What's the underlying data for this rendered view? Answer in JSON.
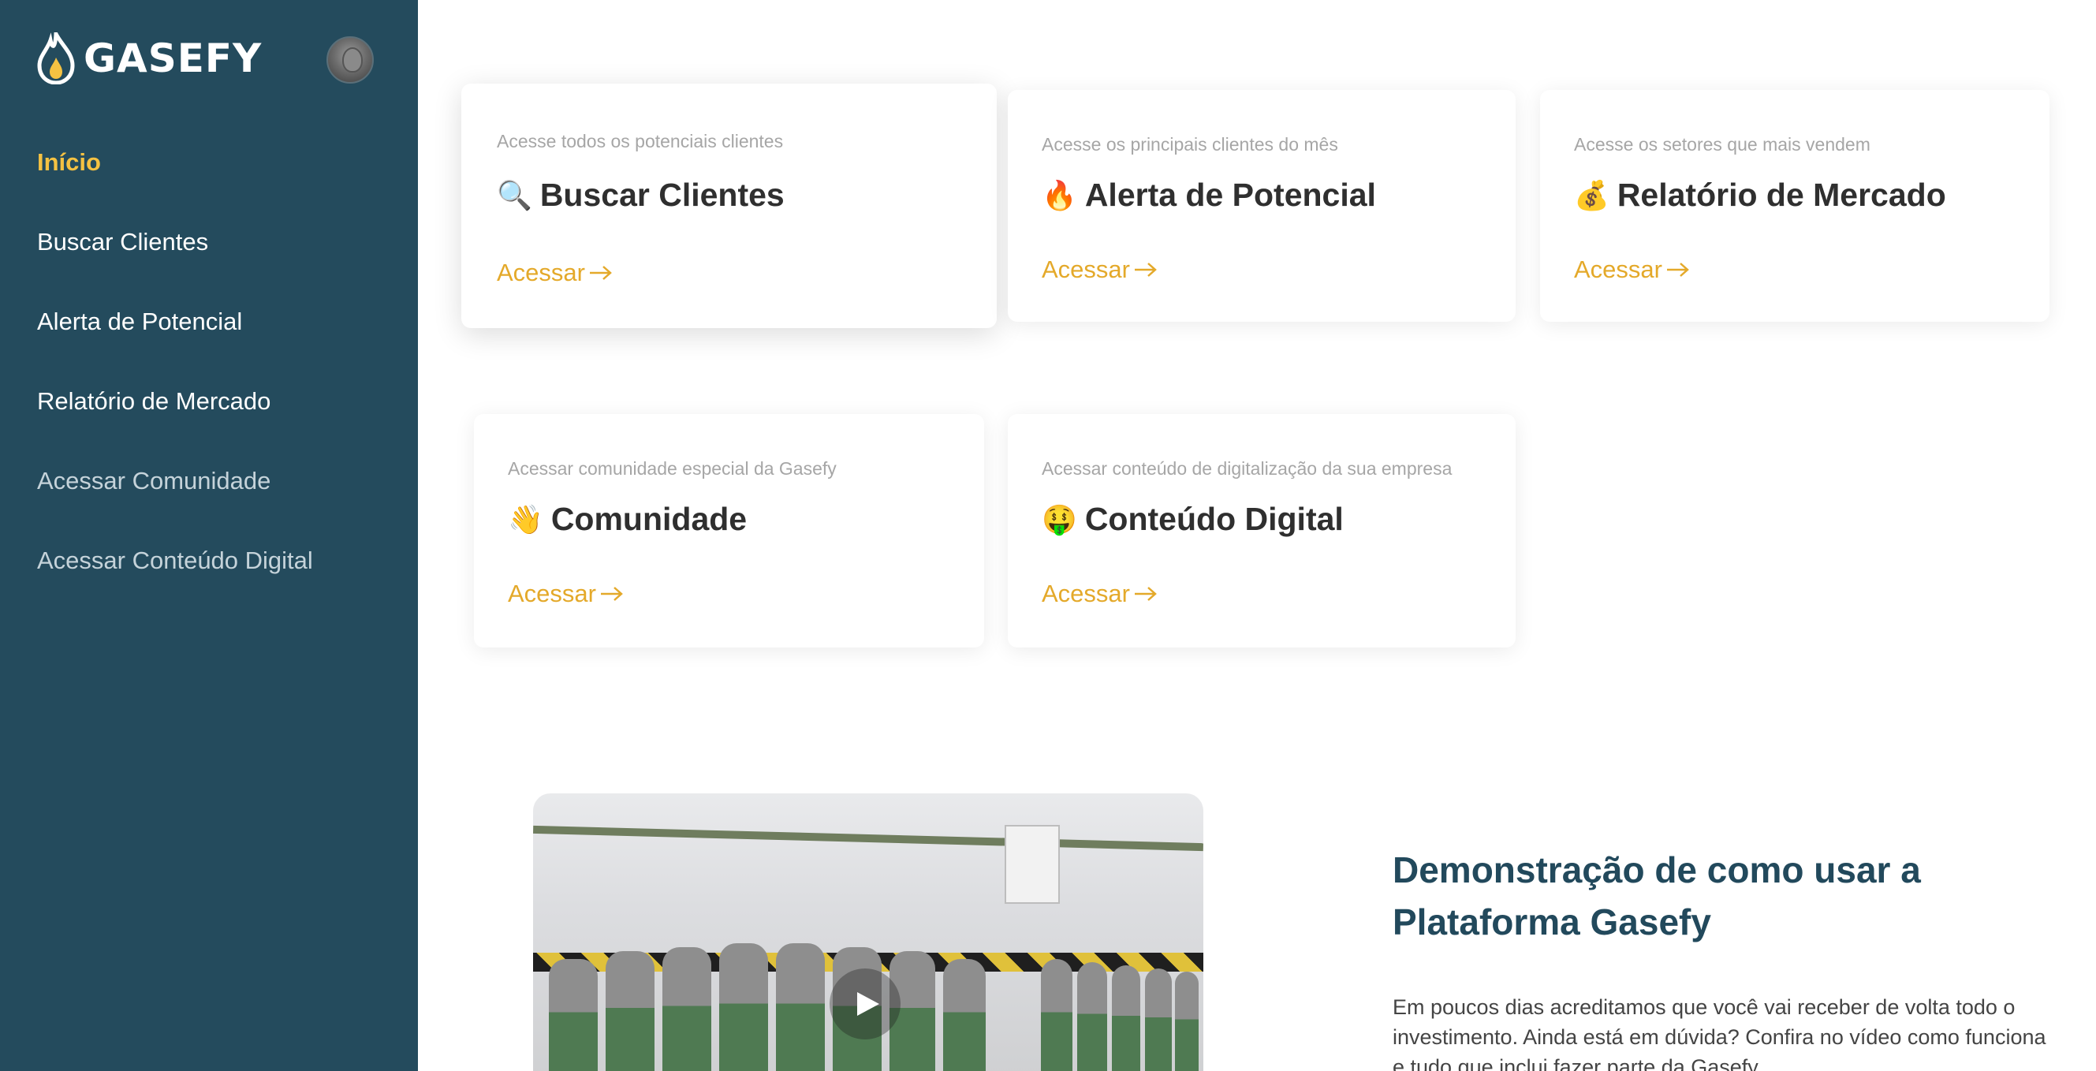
{
  "brand": {
    "name": "GASEFY"
  },
  "sidebar": {
    "items": [
      {
        "label": "Início"
      },
      {
        "label": "Buscar Clientes"
      },
      {
        "label": "Alerta de Potencial"
      },
      {
        "label": "Relatório de Mercado"
      },
      {
        "label": "Acessar Comunidade"
      },
      {
        "label": "Acessar Conteúdo Digital"
      }
    ]
  },
  "cards": [
    {
      "subtitle": "Acesse todos os potenciais clientes",
      "emoji": "🔍",
      "title": "Buscar Clientes",
      "link": "Acessar"
    },
    {
      "subtitle": "Acesse os principais clientes do mês",
      "emoji": "🔥",
      "title": "Alerta de Potencial",
      "link": "Acessar"
    },
    {
      "subtitle": "Acesse os setores que mais vendem",
      "emoji": "💰",
      "title": "Relatório de Mercado",
      "link": "Acessar"
    },
    {
      "subtitle": "Acessar comunidade especial da Gasefy",
      "emoji": "👋",
      "title": "Comunidade",
      "link": "Acessar"
    },
    {
      "subtitle": "Acessar conteúdo de digitalização da sua empresa",
      "emoji": "🤑",
      "title": "Conteúdo Digital",
      "link": "Acessar"
    }
  ],
  "demo": {
    "title": "Demonstração de como usar a Plataforma Gasefy",
    "text": "Em poucos dias acreditamos que você vai receber de volta todo o investimento. Ainda está em dúvida? Confira no vídeo como funciona e tudo que inclui fazer parte da Gasefy."
  },
  "colors": {
    "sidebar_bg": "#244b5d",
    "accent": "#f5c242",
    "link": "#e4a92a",
    "heading": "#22495c"
  }
}
